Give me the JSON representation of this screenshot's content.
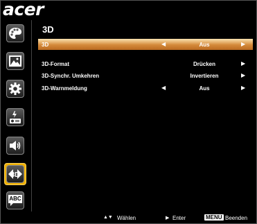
{
  "brand": {
    "logo_text": "acer"
  },
  "sidebar": {
    "items": [
      {
        "name": "color-icon"
      },
      {
        "name": "image-icon"
      },
      {
        "name": "settings-icon"
      },
      {
        "name": "management-icon"
      },
      {
        "name": "audio-icon"
      },
      {
        "name": "3d-icon",
        "label": "3D",
        "active": true
      },
      {
        "name": "language-icon",
        "label": "ABC"
      }
    ]
  },
  "panel": {
    "title": "3D",
    "rows": [
      {
        "label": "3D",
        "value": "Aus",
        "left_arrow": true,
        "right_arrow": true,
        "selected": true
      },
      {
        "label": "3D-Format",
        "value": "Drücken",
        "left_arrow": false,
        "right_arrow": true,
        "selected": false
      },
      {
        "label": "3D-Synchr. Umkehren",
        "value": "Invertieren",
        "left_arrow": false,
        "right_arrow": true,
        "selected": false
      },
      {
        "label": "3D-Warnmeldung",
        "value": "Aus",
        "left_arrow": true,
        "right_arrow": true,
        "selected": false
      }
    ],
    "arrow_left": "◀",
    "arrow_right": "▶"
  },
  "footer": {
    "select_keys": "▲▼",
    "select_label": "Wählen",
    "enter_key": "▶",
    "enter_label": "Enter",
    "menu_key": "MENU",
    "exit_label": "Beenden"
  },
  "colors": {
    "accent": "#f0b000",
    "selected_row": "#d58a3a",
    "background": "#000000"
  }
}
